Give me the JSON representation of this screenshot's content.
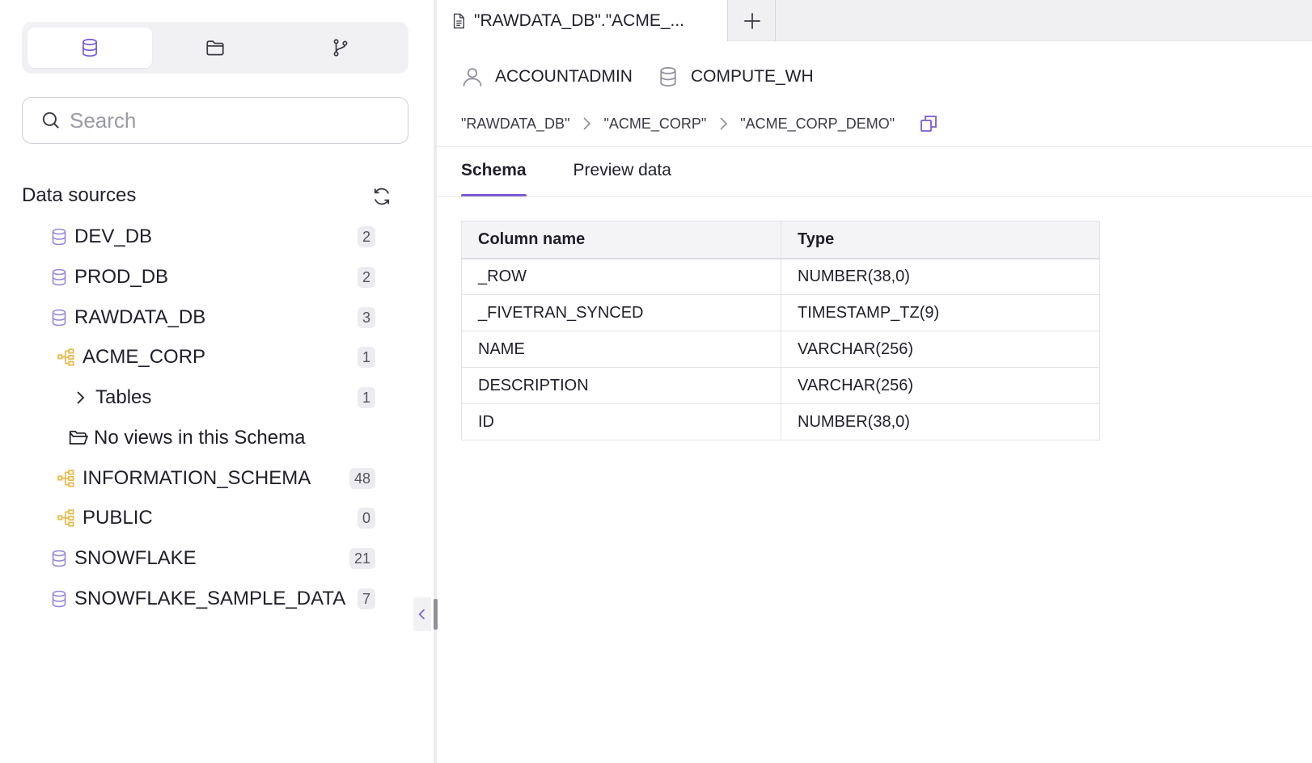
{
  "sidebar": {
    "segments": [
      {
        "icon": "database-icon",
        "active": true
      },
      {
        "icon": "folder-icon",
        "active": false
      },
      {
        "icon": "git-branch-icon",
        "active": false
      }
    ],
    "search_placeholder": "Search",
    "section_title": "Data sources",
    "tree": [
      {
        "label": "DEV_DB",
        "icon": "database-icon",
        "count": "2"
      },
      {
        "label": "PROD_DB",
        "icon": "database-icon",
        "count": "2"
      },
      {
        "label": "RAWDATA_DB",
        "icon": "database-icon",
        "count": "3"
      },
      {
        "label": "ACME_CORP",
        "icon": "schema-icon",
        "count": "1"
      },
      {
        "label": "Tables",
        "icon": "chevron-right-icon",
        "count": "1"
      },
      {
        "label": "No views in this Schema",
        "icon": "folder-open-icon"
      },
      {
        "label": "INFORMATION_SCHEMA",
        "icon": "schema-icon",
        "count": "48"
      },
      {
        "label": "PUBLIC",
        "icon": "schema-icon",
        "count": "0"
      },
      {
        "label": "SNOWFLAKE",
        "icon": "database-icon",
        "count": "21"
      },
      {
        "label": "SNOWFLAKE_SAMPLE_DATA",
        "icon": "database-icon",
        "count": "7"
      }
    ]
  },
  "main": {
    "tab_title": "\"RAWDATA_DB\".\"ACME_...",
    "context": {
      "role": "ACCOUNTADMIN",
      "warehouse": "COMPUTE_WH"
    },
    "breadcrumb": [
      "\"RAWDATA_DB\"",
      "\"ACME_CORP\"",
      "\"ACME_CORP_DEMO\""
    ],
    "tabs": [
      {
        "label": "Schema",
        "active": true
      },
      {
        "label": "Preview data",
        "active": false
      }
    ],
    "table": {
      "headers": [
        "Column name",
        "Type"
      ],
      "rows": [
        [
          "_ROW",
          "NUMBER(38,0)"
        ],
        [
          "_FIVETRAN_SYNCED",
          "TIMESTAMP_TZ(9)"
        ],
        [
          "NAME",
          "VARCHAR(256)"
        ],
        [
          "DESCRIPTION",
          "VARCHAR(256)"
        ],
        [
          "ID",
          "NUMBER(38,0)"
        ]
      ]
    }
  },
  "colors": {
    "accent": "#7b5bd6",
    "schema_icon": "#e8b84a",
    "db_icon": "#9b85dc"
  }
}
